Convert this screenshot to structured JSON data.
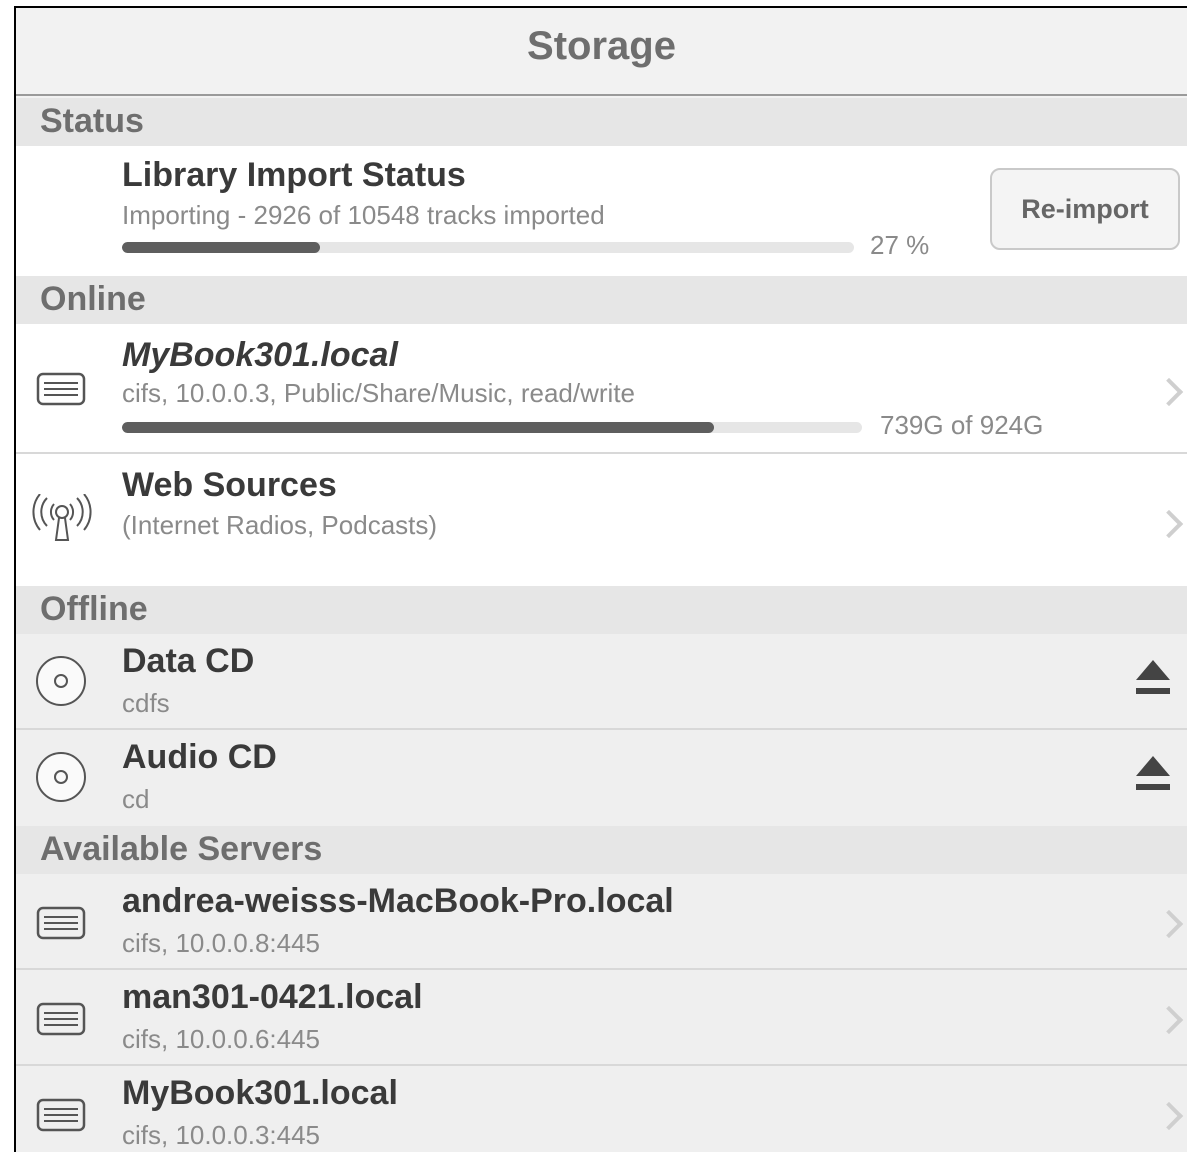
{
  "nav": {
    "title": "Storage"
  },
  "sections": {
    "status": "Status",
    "online": "Online",
    "offline": "Offline",
    "available_servers": "Available Servers"
  },
  "status": {
    "title": "Library Import Status",
    "subtitle": "Importing - 2926 of 10548 tracks imported",
    "progress_percent": 27,
    "progress_label": "27 %",
    "button_label": "Re-import"
  },
  "online": [
    {
      "title": "MyBook301.local",
      "subtitle": "cifs, 10.0.0.3, Public/Share/Music, read/write",
      "usage_label": "739G of 924G",
      "usage_fraction": 0.8,
      "icon": "server-icon"
    },
    {
      "title": "Web Sources",
      "subtitle": "(Internet Radios, Podcasts)",
      "icon": "antenna-icon"
    }
  ],
  "offline": [
    {
      "title": "Data CD",
      "subtitle": "cdfs",
      "icon": "cd-icon",
      "action_icon": "eject-icon"
    },
    {
      "title": "Audio CD",
      "subtitle": "cd",
      "icon": "cd-icon",
      "action_icon": "eject-icon"
    }
  ],
  "servers": [
    {
      "title": "andrea-weisss-MacBook-Pro.local",
      "subtitle": "cifs, 10.0.0.8:445",
      "icon": "server-icon"
    },
    {
      "title": "man301-0421.local",
      "subtitle": "cifs, 10.0.0.6:445",
      "icon": "server-icon"
    },
    {
      "title": "MyBook301.local",
      "subtitle": "cifs, 10.0.0.3:445",
      "icon": "server-icon"
    }
  ],
  "colors": {
    "header_text": "#6e6e6e",
    "section_bg": "#e6e6e6",
    "progress_fill": "#5e5e5e"
  }
}
